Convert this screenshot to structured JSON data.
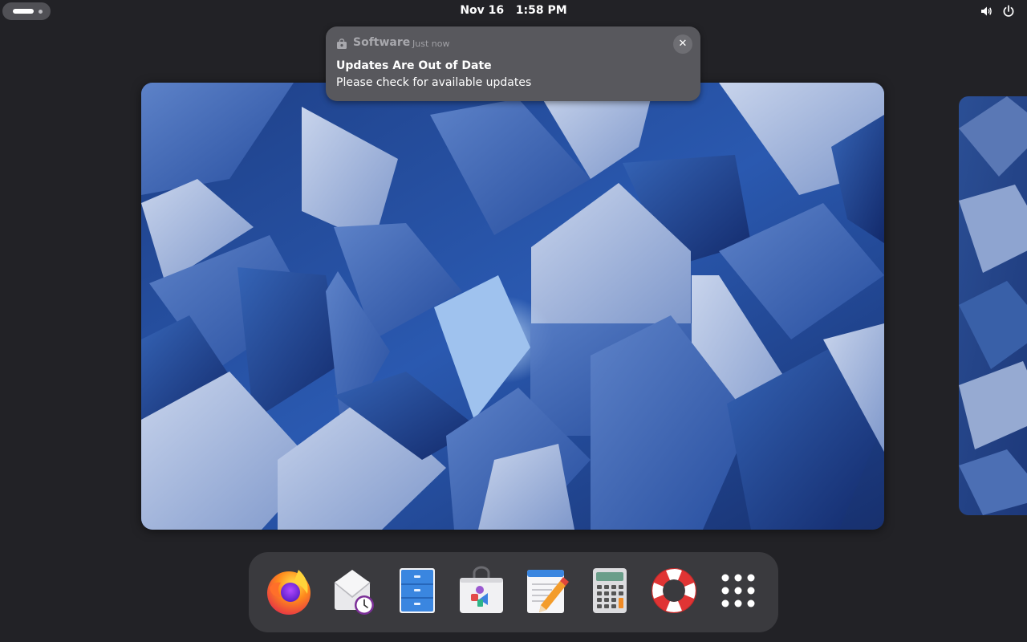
{
  "topbar": {
    "clock_date": "Nov 16",
    "clock_time": "1:58 PM",
    "tray": [
      "volume-icon",
      "power-icon"
    ]
  },
  "notification": {
    "app_name": "Software",
    "time": "Just now",
    "title": "Updates Are Out of Date",
    "body": "Please check for available updates"
  },
  "dash": {
    "apps": [
      "Firefox",
      "Evolution",
      "Files",
      "Software",
      "Text Editor",
      "Calculator",
      "Help",
      "Show Apps"
    ]
  },
  "colors": {
    "background": "#222226",
    "notification_bg": "#58585d",
    "dash_bg": "#3a3a3e"
  }
}
